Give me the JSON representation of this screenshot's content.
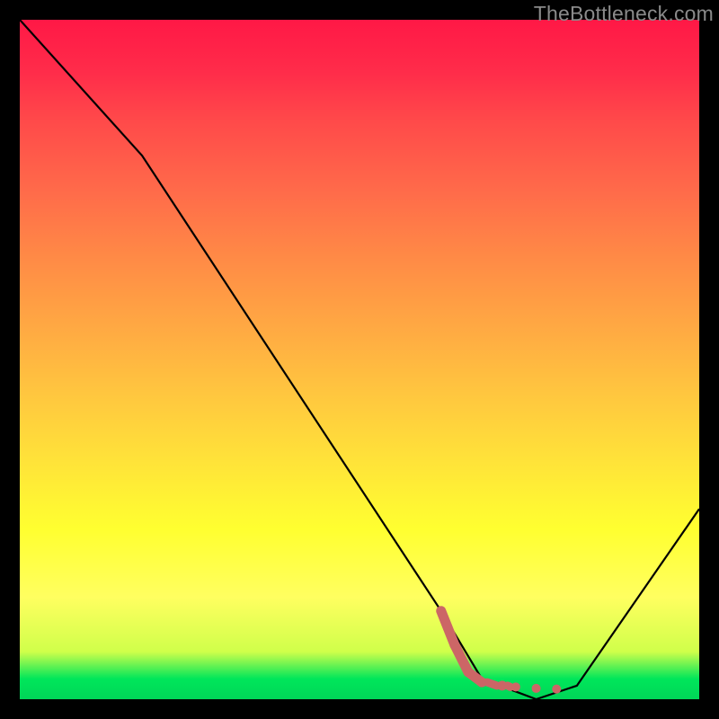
{
  "watermark": "TheBottleneck.com",
  "chart_data": {
    "type": "line",
    "title": "",
    "xlabel": "",
    "ylabel": "",
    "xlim": [
      0,
      100
    ],
    "ylim": [
      0,
      100
    ],
    "series": [
      {
        "name": "curve",
        "x": [
          0,
          18,
          62,
          68,
          76,
          82,
          100
        ],
        "y": [
          100,
          80,
          13,
          3,
          0,
          2,
          28
        ]
      }
    ],
    "highlight": {
      "name": "marker-segment",
      "color": "#cc6666",
      "points": [
        {
          "x": 62,
          "y": 13
        },
        {
          "x": 64,
          "y": 8
        },
        {
          "x": 66,
          "y": 4
        },
        {
          "x": 68,
          "y": 2.5
        },
        {
          "x": 71,
          "y": 2
        },
        {
          "x": 73,
          "y": 1.8
        },
        {
          "x": 76,
          "y": 1.6
        },
        {
          "x": 79,
          "y": 1.5
        }
      ]
    }
  }
}
